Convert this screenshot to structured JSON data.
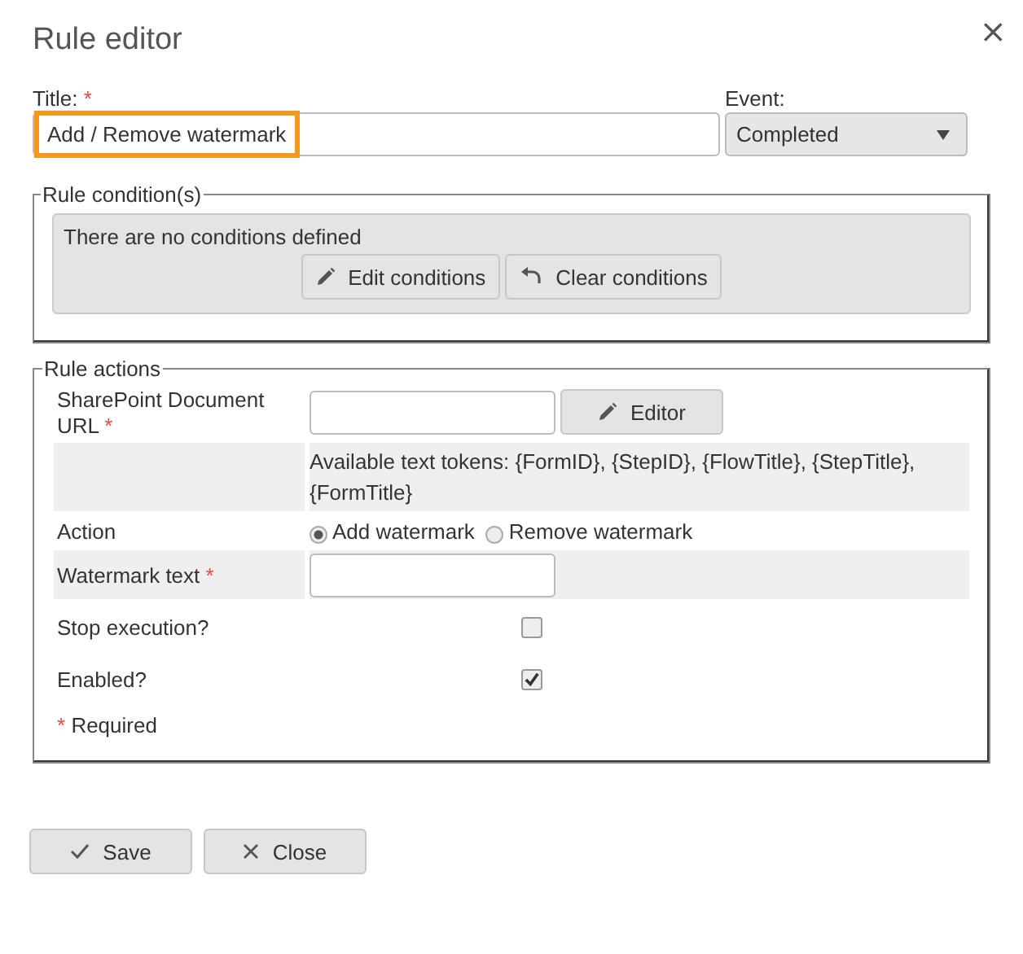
{
  "dialog": {
    "title": "Rule editor",
    "close": "×"
  },
  "title_field": {
    "label": "Title:",
    "required_mark": "*",
    "value": "Add / Remove watermark",
    "highlighted": true
  },
  "event_field": {
    "label": "Event:",
    "value": "Completed"
  },
  "conditions": {
    "legend": "Rule condition(s)",
    "message": "There are no conditions defined",
    "buttons": [
      {
        "kind": "edit",
        "label": "Edit conditions"
      },
      {
        "kind": "undo",
        "label": "Clear conditions"
      }
    ]
  },
  "actions": {
    "legend": "Rule actions",
    "rows": [
      {
        "kind": "text_button",
        "label": "SharePoint Document URL",
        "required_mark": "*",
        "button": "Editor"
      },
      {
        "kind": "hint",
        "text": "Available text tokens: {FormID}, {StepID}, {FlowTitle}, {StepTitle}, {FormTitle}"
      },
      {
        "kind": "radio",
        "label": "Action",
        "options": [
          {
            "label": "Add watermark",
            "selected": true
          },
          {
            "label": "Remove watermark",
            "selected": false
          }
        ]
      },
      {
        "kind": "text",
        "label": "Watermark text",
        "required_mark": "*"
      },
      {
        "kind": "checkbox",
        "label": "Stop execution?",
        "checked": false
      },
      {
        "kind": "checkbox",
        "label": "Enabled?",
        "checked": true
      }
    ],
    "note": {
      "mark": "*",
      "text": "Required"
    }
  },
  "footer_buttons": [
    {
      "kind": "save",
      "label": "Save"
    },
    {
      "kind": "close",
      "label": "Close"
    }
  ]
}
